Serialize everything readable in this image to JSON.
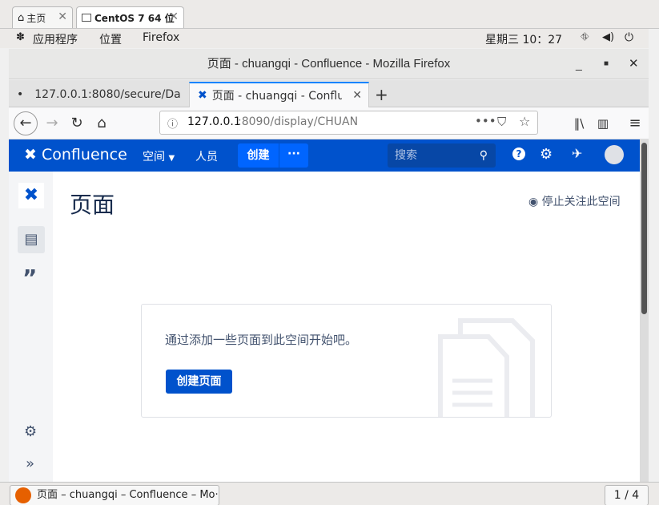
{
  "host": {
    "tabs": [
      {
        "label": "主页"
      },
      {
        "label": "CentOS 7 64 位"
      }
    ],
    "menu": {
      "apps": "应用程序",
      "places": "位置",
      "firefox": "Firefox"
    },
    "clock": "星期三 10：27"
  },
  "firefox": {
    "window_title": "页面 - chuangqi - Confluence - Mozilla Firefox",
    "tabs": [
      {
        "label": "127.0.0.1:8080/secure/Da"
      },
      {
        "label": "页面 - chuangqi - Conflue"
      }
    ],
    "url": {
      "host": "127.0.0.1",
      "rest": ":8090/display/CHUAN"
    }
  },
  "confluence": {
    "logo": "Confluence",
    "nav": {
      "spaces": "空间",
      "people": "人员",
      "create": "创建",
      "more": "···"
    },
    "search_placeholder": "搜索",
    "page_title": "页面",
    "watch_label": "停止关注此空间",
    "empty_message": "通过添加一些页面到此空间开始吧。",
    "create_page_button": "创建页面"
  },
  "taskbar": {
    "task_label": "页面 – chuangqi – Confluence – Mo···",
    "pager": "1 / 4"
  },
  "colors": {
    "brand": "#0052cc",
    "create": "#0065ff",
    "search": "#0747a6"
  }
}
